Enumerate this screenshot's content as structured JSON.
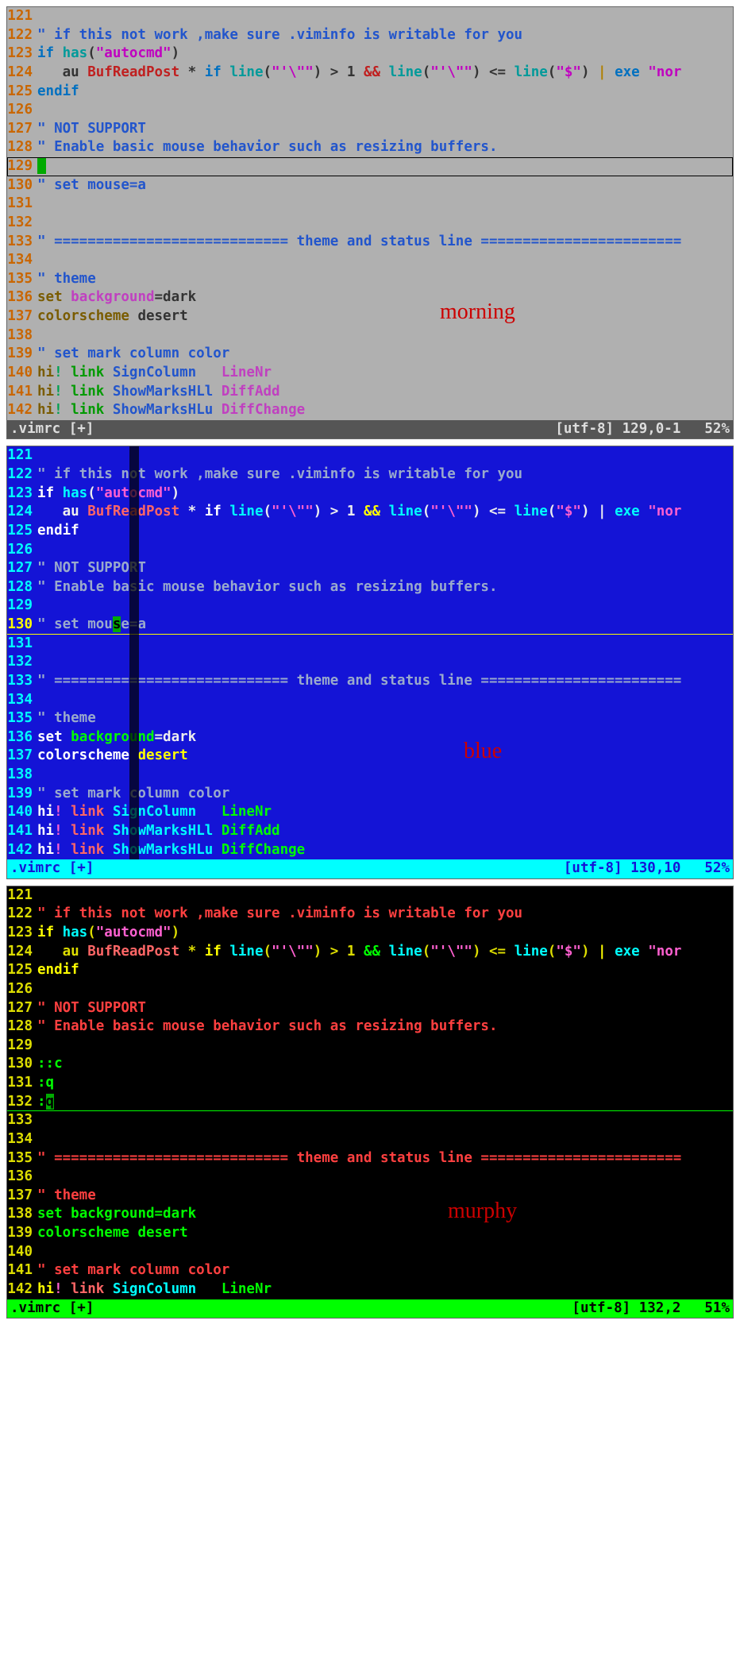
{
  "labels": {
    "morning": "morning",
    "blue": "blue",
    "murphy": "murphy"
  },
  "morning": {
    "lines": [
      "121",
      "122",
      "123",
      "124",
      "125",
      "126",
      "127",
      "128",
      "129",
      "130",
      "131",
      "132",
      "133",
      "134",
      "135",
      "136",
      "137",
      "138",
      "139",
      "140",
      "141",
      "142"
    ],
    "t122": "\" if this not work ,make sure .viminfo is writable for you",
    "t123_if": "if ",
    "t123_has": "has",
    "t123_p1": "(",
    "t123_str": "\"autocmd\"",
    "t123_p2": ")",
    "t124_pre": "   au ",
    "t124_bfr": "BufReadPost",
    "t124_star": " * ",
    "t124_if": "if ",
    "t124_line": "line",
    "t124_a1": "(",
    "t124_s1": "\"'\\\"\"",
    "t124_a2": ") > 1 ",
    "t124_and": "&& ",
    "t124_a3": "(",
    "t124_s2": "\"'\\\"\"",
    "t124_a4": ") <= ",
    "t124_a5": "(",
    "t124_s3": "\"$\"",
    "t124_a6": ") ",
    "t124_pipe": "| ",
    "t124_exe": "exe ",
    "t124_s4": "\"nor",
    "t125": "endif",
    "t127": "\" NOT SUPPORT",
    "t128": "\" Enable basic mouse behavior such as resizing buffers.",
    "t130": "\" set mouse=a",
    "t133": "\" ============================ theme and status line ========================",
    "t135": "\" theme",
    "t136_set": "set ",
    "t136_opt": "background",
    "t136_eq": "=dark",
    "t137_cs": "colorscheme ",
    "t137_nm": "desert",
    "t139": "\" set mark column color",
    "t140_hi": "hi",
    "t140_bang": "! ",
    "t140_link": "link ",
    "t140_g1": "SignColumn   ",
    "t140_g2": "LineNr",
    "t141_hi": "hi",
    "t141_bang": "! ",
    "t141_link": "link ",
    "t141_g1": "ShowMarksHLl ",
    "t141_g2": "DiffAdd",
    "t142_hi": "hi",
    "t142_bang": "! ",
    "t142_link": "link ",
    "t142_g1": "ShowMarksHLu ",
    "t142_g2": "DiffChange",
    "status_left": ".vimrc [+]",
    "status_mid": "[utf-8] 129,0-1",
    "status_right": "52%"
  },
  "blue": {
    "lines": [
      "121",
      "122",
      "123",
      "124",
      "125",
      "126",
      "127",
      "128",
      "129",
      "130",
      "131",
      "132",
      "133",
      "134",
      "135",
      "136",
      "137",
      "138",
      "139",
      "140",
      "141",
      "142"
    ],
    "t130_a": "\" set mou",
    "t130_b": "s",
    "t130_c": "e=a",
    "status_left": ".vimrc [+]",
    "status_mid": "[utf-8] 130,10",
    "status_right": "52%"
  },
  "murphy": {
    "lines": [
      "121",
      "122",
      "123",
      "124",
      "125",
      "126",
      "127",
      "128",
      "129",
      "130",
      "131",
      "132",
      "133",
      "134",
      "135",
      "136",
      "137",
      "138",
      "139",
      "140",
      "141",
      "142"
    ],
    "t130": "::c",
    "t131": ":q",
    "t132_a": ":",
    "t132_b": "q",
    "status_left": ".vimrc [+]",
    "status_mid": "[utf-8] 132,2",
    "status_right": "51%"
  }
}
